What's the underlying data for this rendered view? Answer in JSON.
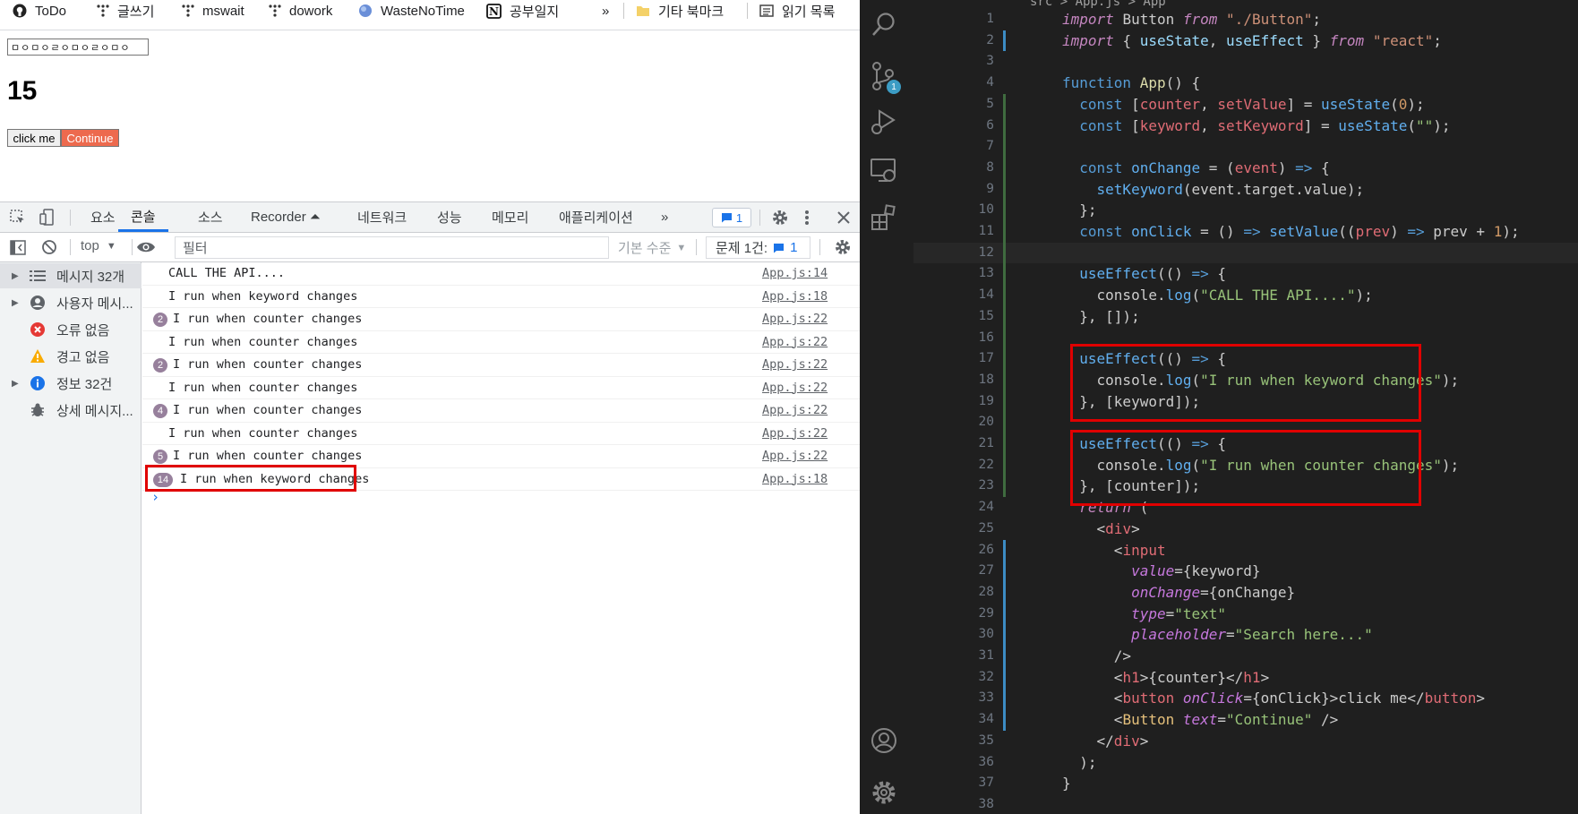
{
  "bookmarks": {
    "items": [
      {
        "label": "ToDo",
        "icon": "github-icon"
      },
      {
        "label": "글쓰기",
        "icon": "dots-icon"
      },
      {
        "label": "mswait",
        "icon": "dots-icon"
      },
      {
        "label": "dowork",
        "icon": "dots-icon"
      },
      {
        "label": "WasteNoTime",
        "icon": "globe-icon"
      },
      {
        "label": "공부일지",
        "icon": "notion-icon"
      }
    ],
    "more": "»",
    "folder": "기타 북마크",
    "reading_list": "읽기 목록"
  },
  "app": {
    "search_value": "ㅁㅇㅁㅇㄹㅇㅁㅇㄹㅇㅁㅇ",
    "counter": "15",
    "button_label": "click me",
    "continue_label": "Continue"
  },
  "devtools": {
    "tabs": [
      "요소",
      "콘솔",
      "소스",
      "Recorder ⏶",
      "네트워크",
      "성능",
      "메모리",
      "애플리케이션"
    ],
    "active_tab": "콘솔",
    "more_tabs": "»",
    "issues_count": "1",
    "context": "top",
    "filter_placeholder": "필터",
    "level": "기본 수준",
    "issues_label": "문제 1건:",
    "issues_badge": "1",
    "sidebar": [
      {
        "label": "메시지 32개",
        "icon": "list-icon",
        "expandable": true
      },
      {
        "label": "사용자 메시...",
        "icon": "user-icon",
        "expandable": true
      },
      {
        "label": "오류 없음",
        "icon": "error-icon",
        "expandable": false
      },
      {
        "label": "경고 없음",
        "icon": "warning-icon",
        "expandable": false
      },
      {
        "label": "정보 32건",
        "icon": "info-icon",
        "expandable": true
      },
      {
        "label": "상세 메시지...",
        "icon": "bug-icon",
        "expandable": false
      }
    ],
    "logs": [
      {
        "count": "",
        "msg": "CALL THE API....",
        "src": "App.js:14"
      },
      {
        "count": "",
        "msg": "I run when keyword changes",
        "src": "App.js:18"
      },
      {
        "count": "2",
        "msg": "I run when counter changes",
        "src": "App.js:22"
      },
      {
        "count": "",
        "msg": "I run when counter changes",
        "src": "App.js:22"
      },
      {
        "count": "2",
        "msg": "I run when counter changes",
        "src": "App.js:22"
      },
      {
        "count": "",
        "msg": "I run when counter changes",
        "src": "App.js:22"
      },
      {
        "count": "4",
        "msg": "I run when counter changes",
        "src": "App.js:22"
      },
      {
        "count": "",
        "msg": "I run when counter changes",
        "src": "App.js:22"
      },
      {
        "count": "5",
        "msg": "I run when counter changes",
        "src": "App.js:22"
      },
      {
        "count": "14",
        "msg": "I run when keyword changes",
        "src": "App.js:18"
      }
    ],
    "prompt": "›"
  },
  "editor": {
    "breadcrumb": "src > App.js > App",
    "scm_badge": "1",
    "lines": [
      {
        "n": "1",
        "html": "<span class='kwi'>import</span> <span class='pl'>Button</span> <span class='kwi'>from</span> <span class='str'>\"./Button\"</span><span class='pl'>;</span>"
      },
      {
        "n": "2",
        "html": "<span class='kwi'>import</span> <span class='pl'>{ </span><span class='var'>useState</span><span class='pl'>, </span><span class='var'>useEffect</span><span class='pl'> }</span> <span class='kwi'>from</span> <span class='str'>\"react\"</span><span class='pl'>;</span>"
      },
      {
        "n": "3",
        "html": ""
      },
      {
        "n": "4",
        "html": "<span class='kw'>function</span> <span class='fn'>App</span><span class='pl'>() {</span>"
      },
      {
        "n": "5",
        "html": "  <span class='kw'>const</span> <span class='pl'>[</span><span class='var' style='color:#e06c75'>counter</span><span class='pl'>, </span><span class='var' style='color:#e06c75'>setValue</span><span class='pl'>] = </span><span class='fn' style='color:#61afef'>useState</span><span class='pl'>(</span><span class='num' style='color:#d19a66'>0</span><span class='pl'>);</span>"
      },
      {
        "n": "6",
        "html": "  <span class='kw'>const</span> <span class='pl'>[</span><span class='var' style='color:#e06c75'>keyword</span><span class='pl'>, </span><span class='var' style='color:#e06c75'>setKeyword</span><span class='pl'>] = </span><span class='fn' style='color:#61afef'>useState</span><span class='pl'>(</span><span class='str' style='color:#98c379'>\"\"</span><span class='pl'>);</span>"
      },
      {
        "n": "7",
        "html": ""
      },
      {
        "n": "8",
        "html": "  <span class='kw'>const</span> <span class='fn' style='color:#61afef'>onChange</span> <span class='pl'>= (</span><span class='var' style='color:#e06c75'>event</span><span class='pl'>) </span><span class='kw'>=></span> <span class='pl'>{</span>"
      },
      {
        "n": "9",
        "html": "    <span class='fn' style='color:#61afef'>setKeyword</span><span class='pl'>(event.target.value);</span>"
      },
      {
        "n": "10",
        "html": "  <span class='pl'>};</span>"
      },
      {
        "n": "11",
        "html": "  <span class='kw'>const</span> <span class='fn' style='color:#61afef'>onClick</span> <span class='pl'>= () </span><span class='kw'>=></span> <span class='fn' style='color:#61afef'>setValue</span><span class='pl'>((</span><span class='var' style='color:#e06c75'>prev</span><span class='pl'>) </span><span class='kw'>=></span> <span class='pl'>prev + </span><span class='num' style='color:#d19a66'>1</span><span class='pl'>);</span>"
      },
      {
        "n": "12",
        "html": ""
      },
      {
        "n": "13",
        "html": "  <span class='fn' style='color:#61afef'>useEffect</span><span class='pl'>(() </span><span class='kw'>=></span> <span class='pl'>{</span>"
      },
      {
        "n": "14",
        "html": "    <span class='pl'>console.</span><span class='fn' style='color:#61afef'>log</span><span class='pl'>(</span><span class='str' style='color:#98c379'>\"CALL THE API....\"</span><span class='pl'>);</span>"
      },
      {
        "n": "15",
        "html": "  <span class='pl'>}, []);</span>"
      },
      {
        "n": "16",
        "html": ""
      },
      {
        "n": "17",
        "html": "  <span class='fn' style='color:#61afef'>useEffect</span><span class='pl'>(() </span><span class='kw'>=></span> <span class='pl'>{</span>"
      },
      {
        "n": "18",
        "html": "    <span class='pl'>console.</span><span class='fn' style='color:#61afef'>log</span><span class='pl'>(</span><span class='str' style='color:#98c379'>\"I run when keyword changes\"</span><span class='pl'>);</span>"
      },
      {
        "n": "19",
        "html": "  <span class='pl'>}, [keyword]);</span>"
      },
      {
        "n": "20",
        "html": ""
      },
      {
        "n": "21",
        "html": "  <span class='fn' style='color:#61afef'>useEffect</span><span class='pl'>(() </span><span class='kw'>=></span> <span class='pl'>{</span>"
      },
      {
        "n": "22",
        "html": "    <span class='pl'>console.</span><span class='fn' style='color:#61afef'>log</span><span class='pl'>(</span><span class='str' style='color:#98c379'>\"I run when counter changes\"</span><span class='pl'>);</span>"
      },
      {
        "n": "23",
        "html": "  <span class='pl'>}, [counter]);</span>"
      },
      {
        "n": "24",
        "html": "  <span class='kwi'>return</span> <span class='pl'>(</span>"
      },
      {
        "n": "25",
        "html": "    <span class='pl'>&lt;</span><span style='color:#e06c75'>div</span><span class='pl'>&gt;</span>"
      },
      {
        "n": "26",
        "html": "      <span class='pl'>&lt;</span><span style='color:#e06c75'>input</span>"
      },
      {
        "n": "27",
        "html": "        <span class='att' style='color:#c678dd'>value</span><span class='pl'>={keyword}</span>"
      },
      {
        "n": "28",
        "html": "        <span class='att' style='color:#c678dd'>onChange</span><span class='pl'>={onChange}</span>"
      },
      {
        "n": "29",
        "html": "        <span class='att' style='color:#c678dd'>type</span><span class='pl'>=</span><span class='str' style='color:#98c379'>\"text\"</span>"
      },
      {
        "n": "30",
        "html": "        <span class='att' style='color:#c678dd'>placeholder</span><span class='pl'>=</span><span class='str' style='color:#98c379'>\"Search here...\"</span>"
      },
      {
        "n": "31",
        "html": "      <span class='pl'>/&gt;</span>"
      },
      {
        "n": "32",
        "html": "      <span class='pl'>&lt;</span><span style='color:#e06c75'>h1</span><span class='pl'>&gt;{counter}&lt;/</span><span style='color:#e06c75'>h1</span><span class='pl'>&gt;</span>"
      },
      {
        "n": "33",
        "html": "      <span class='pl'>&lt;</span><span style='color:#e06c75'>button</span> <span class='att' style='color:#c678dd'>onClick</span><span class='pl'>={onClick}&gt;click me&lt;/</span><span style='color:#e06c75'>button</span><span class='pl'>&gt;</span>"
      },
      {
        "n": "34",
        "html": "      <span class='pl'>&lt;</span><span style='color:#e5c07b'>Button</span> <span class='att' style='color:#c678dd'>text</span><span class='pl'>=</span><span class='str' style='color:#98c379'>\"Continue\"</span> <span class='pl'>/&gt;</span>"
      },
      {
        "n": "35",
        "html": "    <span class='pl'>&lt;/</span><span style='color:#e06c75'>div</span><span class='pl'>&gt;</span>"
      },
      {
        "n": "36",
        "html": "  <span class='pl'>);</span>"
      },
      {
        "n": "37",
        "html": "<span class='pl'>}</span>"
      },
      {
        "n": "38",
        "html": ""
      }
    ]
  },
  "colors": {
    "highlight": "#e00000",
    "continue_button": "#ed6a4e",
    "devtools_accent": "#1a73e8",
    "editor_bg": "#1f1f1f"
  }
}
